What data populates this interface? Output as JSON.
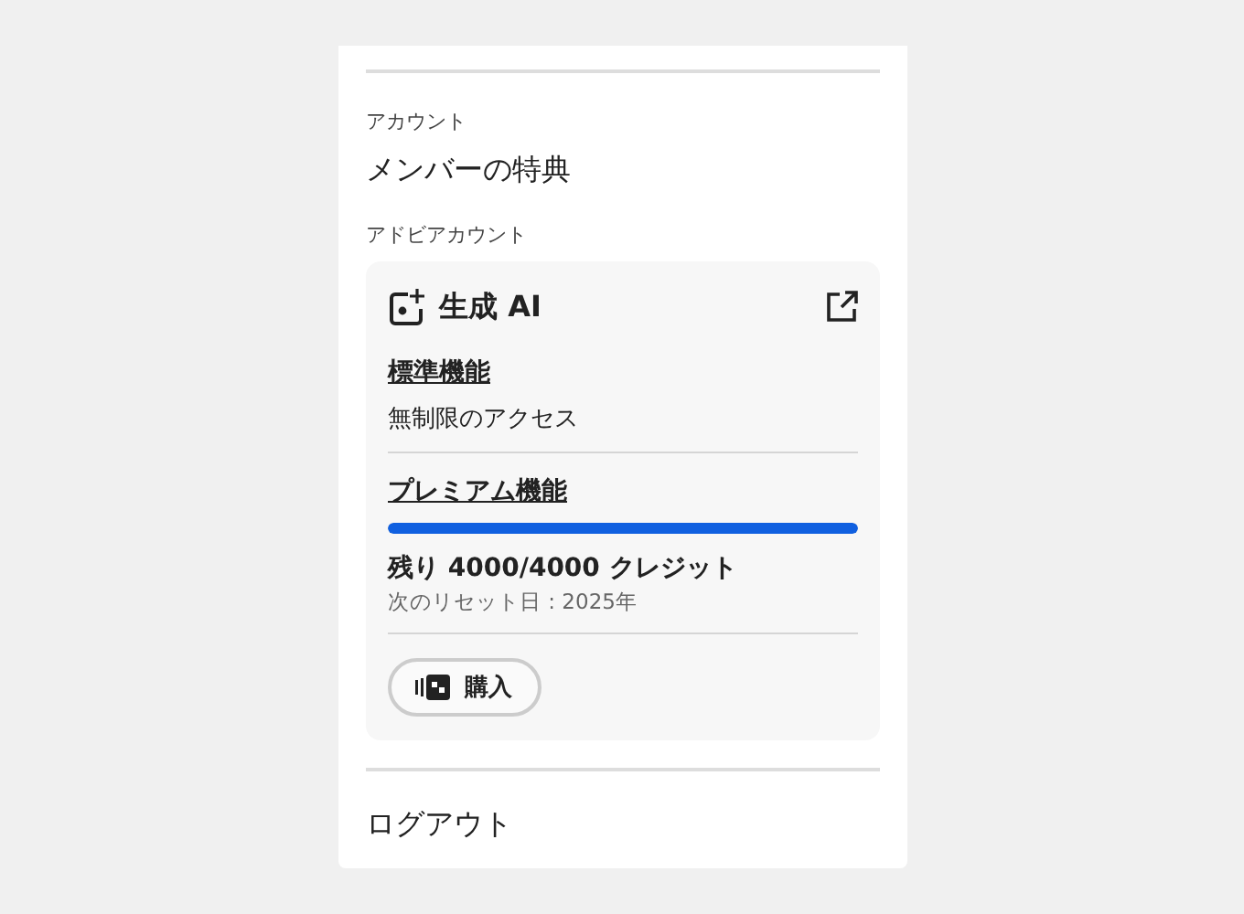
{
  "section_label": "アカウント",
  "member_benefits": "メンバーの特典",
  "account_label": "アドビアカウント",
  "card": {
    "title": "生成 AI",
    "standard": {
      "heading": "標準機能",
      "description": "無制限のアクセス"
    },
    "premium": {
      "heading": "プレミアム機能",
      "level": 1,
      "credits": "残り 4000/4000 クレジット",
      "reset": "次のリセット日 : 2025年"
    },
    "buy_button": "購入"
  },
  "logout": "ログアウト"
}
